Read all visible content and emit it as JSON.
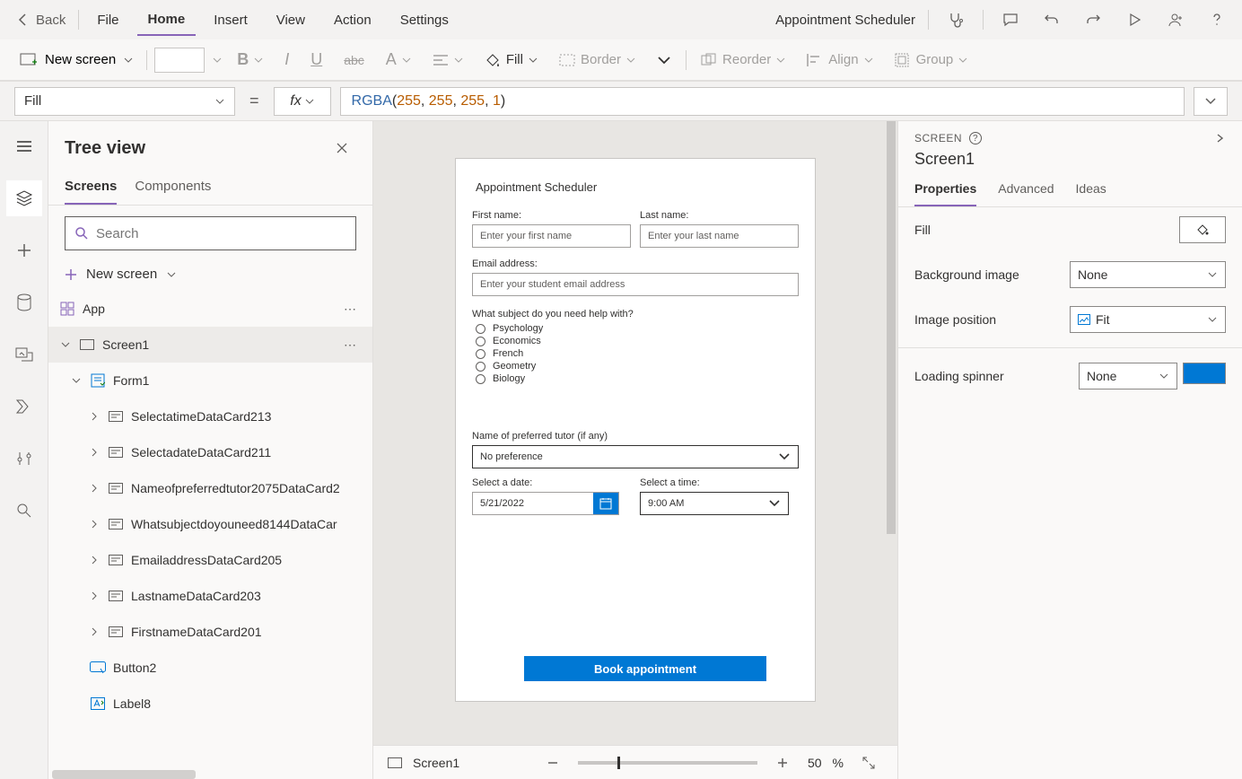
{
  "ribbon": {
    "back": "Back",
    "tabs": [
      "File",
      "Home",
      "Insert",
      "View",
      "Action",
      "Settings"
    ],
    "active_tab": "Home",
    "app_title": "Appointment Scheduler"
  },
  "toolbar": {
    "new_screen": "New screen",
    "fill": "Fill",
    "border": "Border",
    "reorder": "Reorder",
    "align": "Align",
    "group": "Group"
  },
  "formula": {
    "property": "Fill",
    "fx": "fx",
    "fn": "RGBA",
    "args": [
      "255",
      "255",
      "255",
      "1"
    ]
  },
  "tree": {
    "title": "Tree view",
    "tabs": [
      "Screens",
      "Components"
    ],
    "active_tab": "Screens",
    "search_placeholder": "Search",
    "new_screen": "New screen",
    "items": [
      {
        "label": "App",
        "icon": "app",
        "depth": 0,
        "dots": true
      },
      {
        "label": "Screen1",
        "icon": "screen",
        "depth": 0,
        "expanded": true,
        "selected": true,
        "dots": true
      },
      {
        "label": "Form1",
        "icon": "form",
        "depth": 1,
        "expanded": true
      },
      {
        "label": "SelectatimeDataCard213",
        "icon": "card",
        "depth": 2,
        "chev": true
      },
      {
        "label": "SelectadateDataCard211",
        "icon": "card",
        "depth": 2,
        "chev": true
      },
      {
        "label": "Nameofpreferredtutor2075DataCard2",
        "icon": "card",
        "depth": 2,
        "chev": true
      },
      {
        "label": "Whatsubjectdoyouneed8144DataCar",
        "icon": "card",
        "depth": 2,
        "chev": true
      },
      {
        "label": "EmailaddressDataCard205",
        "icon": "card",
        "depth": 2,
        "chev": true
      },
      {
        "label": "LastnameDataCard203",
        "icon": "card",
        "depth": 2,
        "chev": true
      },
      {
        "label": "FirstnameDataCard201",
        "icon": "card",
        "depth": 2,
        "chev": true
      },
      {
        "label": "Button2",
        "icon": "button",
        "depth": 1
      },
      {
        "label": "Label8",
        "icon": "label",
        "depth": 1
      }
    ]
  },
  "canvas": {
    "form": {
      "title": "Appointment Scheduler",
      "first_name_label": "First name:",
      "first_name_ph": "Enter your first name",
      "last_name_label": "Last name:",
      "last_name_ph": "Enter your last name",
      "email_label": "Email address:",
      "email_ph": "Enter your student email address",
      "subject_label": "What subject do you need help with?",
      "subjects": [
        "Psychology",
        "Economics",
        "French",
        "Geometry",
        "Biology"
      ],
      "tutor_label": "Name of preferred tutor (if any)",
      "tutor_ph": "No preference",
      "date_label": "Select a date:",
      "date_value": "5/21/2022",
      "time_label": "Select a time:",
      "time_value": "9:00 AM",
      "book": "Book appointment"
    },
    "footer": {
      "screen_label": "Screen1",
      "zoom": "50",
      "zoom_suffix": "%"
    }
  },
  "props": {
    "kind": "SCREEN",
    "name": "Screen1",
    "tabs": [
      "Properties",
      "Advanced",
      "Ideas"
    ],
    "active_tab": "Properties",
    "rows": {
      "fill": "Fill",
      "bg_image": "Background image",
      "bg_image_val": "None",
      "img_pos": "Image position",
      "img_pos_val": "Fit",
      "spinner": "Loading spinner",
      "spinner_val": "None"
    }
  }
}
